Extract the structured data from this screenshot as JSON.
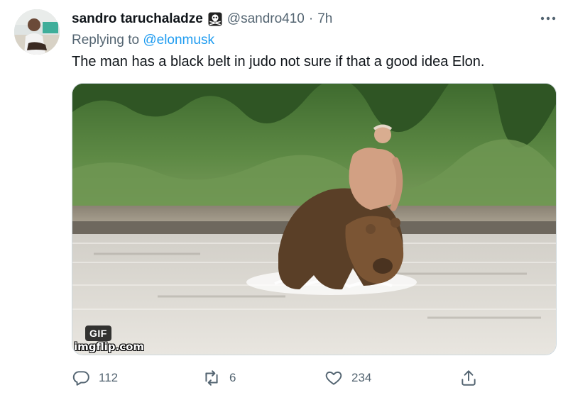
{
  "tweet": {
    "display_name": "sandro taruchaladze",
    "badge_icon": "skull-crossbones-icon",
    "handle": "@sandro410",
    "separator": "·",
    "time": "7h",
    "reply_prefix": "Replying to ",
    "reply_mention": "@elonmusk",
    "text": "The man has a black belt in judo not sure if that a good idea Elon.",
    "media": {
      "gif_label": "GIF",
      "watermark": "imgflip.com"
    }
  },
  "actions": {
    "reply_count": "112",
    "retweet_count": "6",
    "like_count": "234"
  },
  "colors": {
    "link": "#1d9bf0",
    "secondary_text": "#536471",
    "primary_text": "#0f1419"
  }
}
